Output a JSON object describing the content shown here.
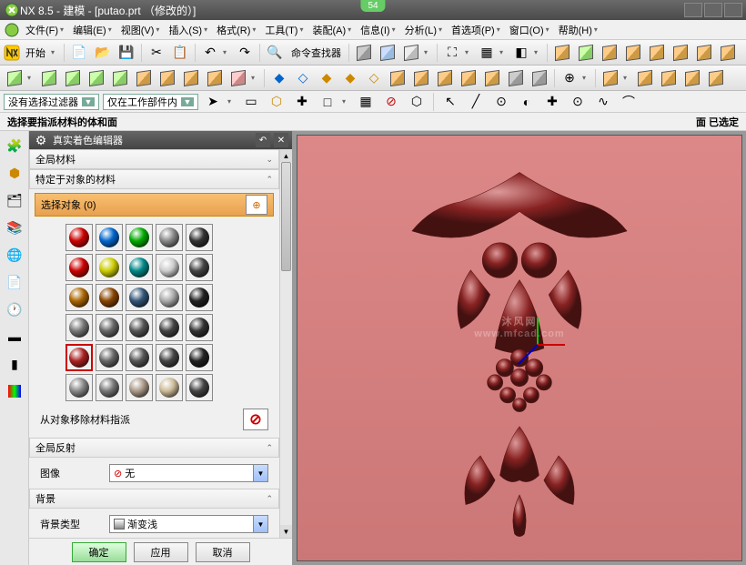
{
  "app": {
    "title": "NX 8.5 - 建模 - [putao.prt （修改的）]",
    "tab_num": "54"
  },
  "menus": [
    "文件(F)",
    "编辑(E)",
    "视图(V)",
    "插入(S)",
    "格式(R)",
    "工具(T)",
    "装配(A)",
    "信息(I)",
    "分析(L)",
    "首选项(P)",
    "窗口(O)",
    "帮助(H)"
  ],
  "toolbar1": {
    "start": "开始",
    "cmd_finder": "命令查找器"
  },
  "filters": {
    "sel_filter": "没有选择过滤器",
    "scope": "仅在工作部件内"
  },
  "status": {
    "left": "选择要指派材料的体和面",
    "right": "面  已选定"
  },
  "dialog": {
    "title": "真实着色编辑器",
    "sec_global_mat": "全局材料",
    "sec_obj_mat": "特定于对象的材料",
    "select_obj": "选择对象  (0)",
    "remove_mat": "从对象移除材料指派",
    "sec_reflect": "全局反射",
    "img_label": "图像",
    "img_value": "无",
    "sec_bg": "背景",
    "bg_type_label": "背景类型",
    "bg_type_value": "渐变浅",
    "btn_ok": "确定",
    "btn_apply": "应用",
    "btn_cancel": "取消"
  },
  "materials": {
    "colors": [
      "#c00",
      "#06c",
      "#0a0",
      "#888",
      "#333",
      "#c00",
      "#cc0",
      "#088",
      "#ccc",
      "#444",
      "#a60",
      "#840",
      "#357",
      "#aaa",
      "#222",
      "#777",
      "#666",
      "#555",
      "#444",
      "#333",
      "#a22",
      "#666",
      "#555",
      "#444",
      "#222",
      "#888",
      "#777",
      "#a98",
      "#cb9",
      "#444"
    ],
    "selected_index": 20
  },
  "watermark": {
    "main": "沐风网",
    "sub": "www.mfcad.com"
  }
}
